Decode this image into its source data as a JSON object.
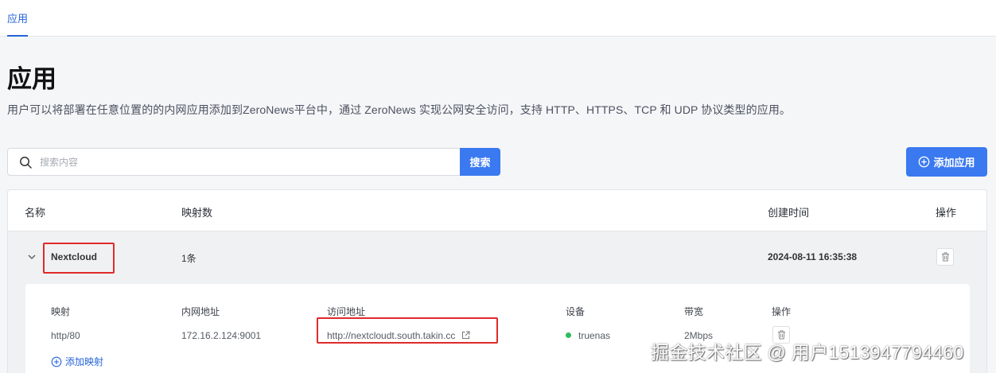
{
  "topbar": {
    "tab_label": "应用"
  },
  "page": {
    "title": "应用",
    "description": "用户可以将部署在任意位置的的内网应用添加到ZeroNews平台中，通过 ZeroNews 实现公网安全访问，支持 HTTP、HTTPS、TCP 和 UDP 协议类型的应用。"
  },
  "search": {
    "placeholder": "搜索内容",
    "button_label": "搜索"
  },
  "add_app_button": {
    "label": "添加应用"
  },
  "table": {
    "headers": {
      "name": "名称",
      "mappings": "映射数",
      "created": "创建时间",
      "actions": "操作"
    },
    "rows": [
      {
        "name": "Nextcloud",
        "mapping_count": "1条",
        "created": "2024-08-11 16:35:38",
        "sub_headers": {
          "mapping": "映射",
          "internal_addr": "内网地址",
          "access_addr": "访问地址",
          "device": "设备",
          "bandwidth": "带宽",
          "actions": "操作"
        },
        "mappings": [
          {
            "mapping": "http/80",
            "internal_addr": "172.16.2.124:9001",
            "access_addr": "http://nextcloudt.south.takin.cc",
            "device": "truenas",
            "bandwidth": "2Mbps"
          }
        ],
        "add_mapping_label": "添加映射"
      }
    ]
  },
  "watermark": "掘金技术社区 @ 用户1513947794460",
  "colors": {
    "accent": "#3a79f0",
    "highlight_box": "#e02a2a",
    "status_online": "#2dbd5a"
  }
}
